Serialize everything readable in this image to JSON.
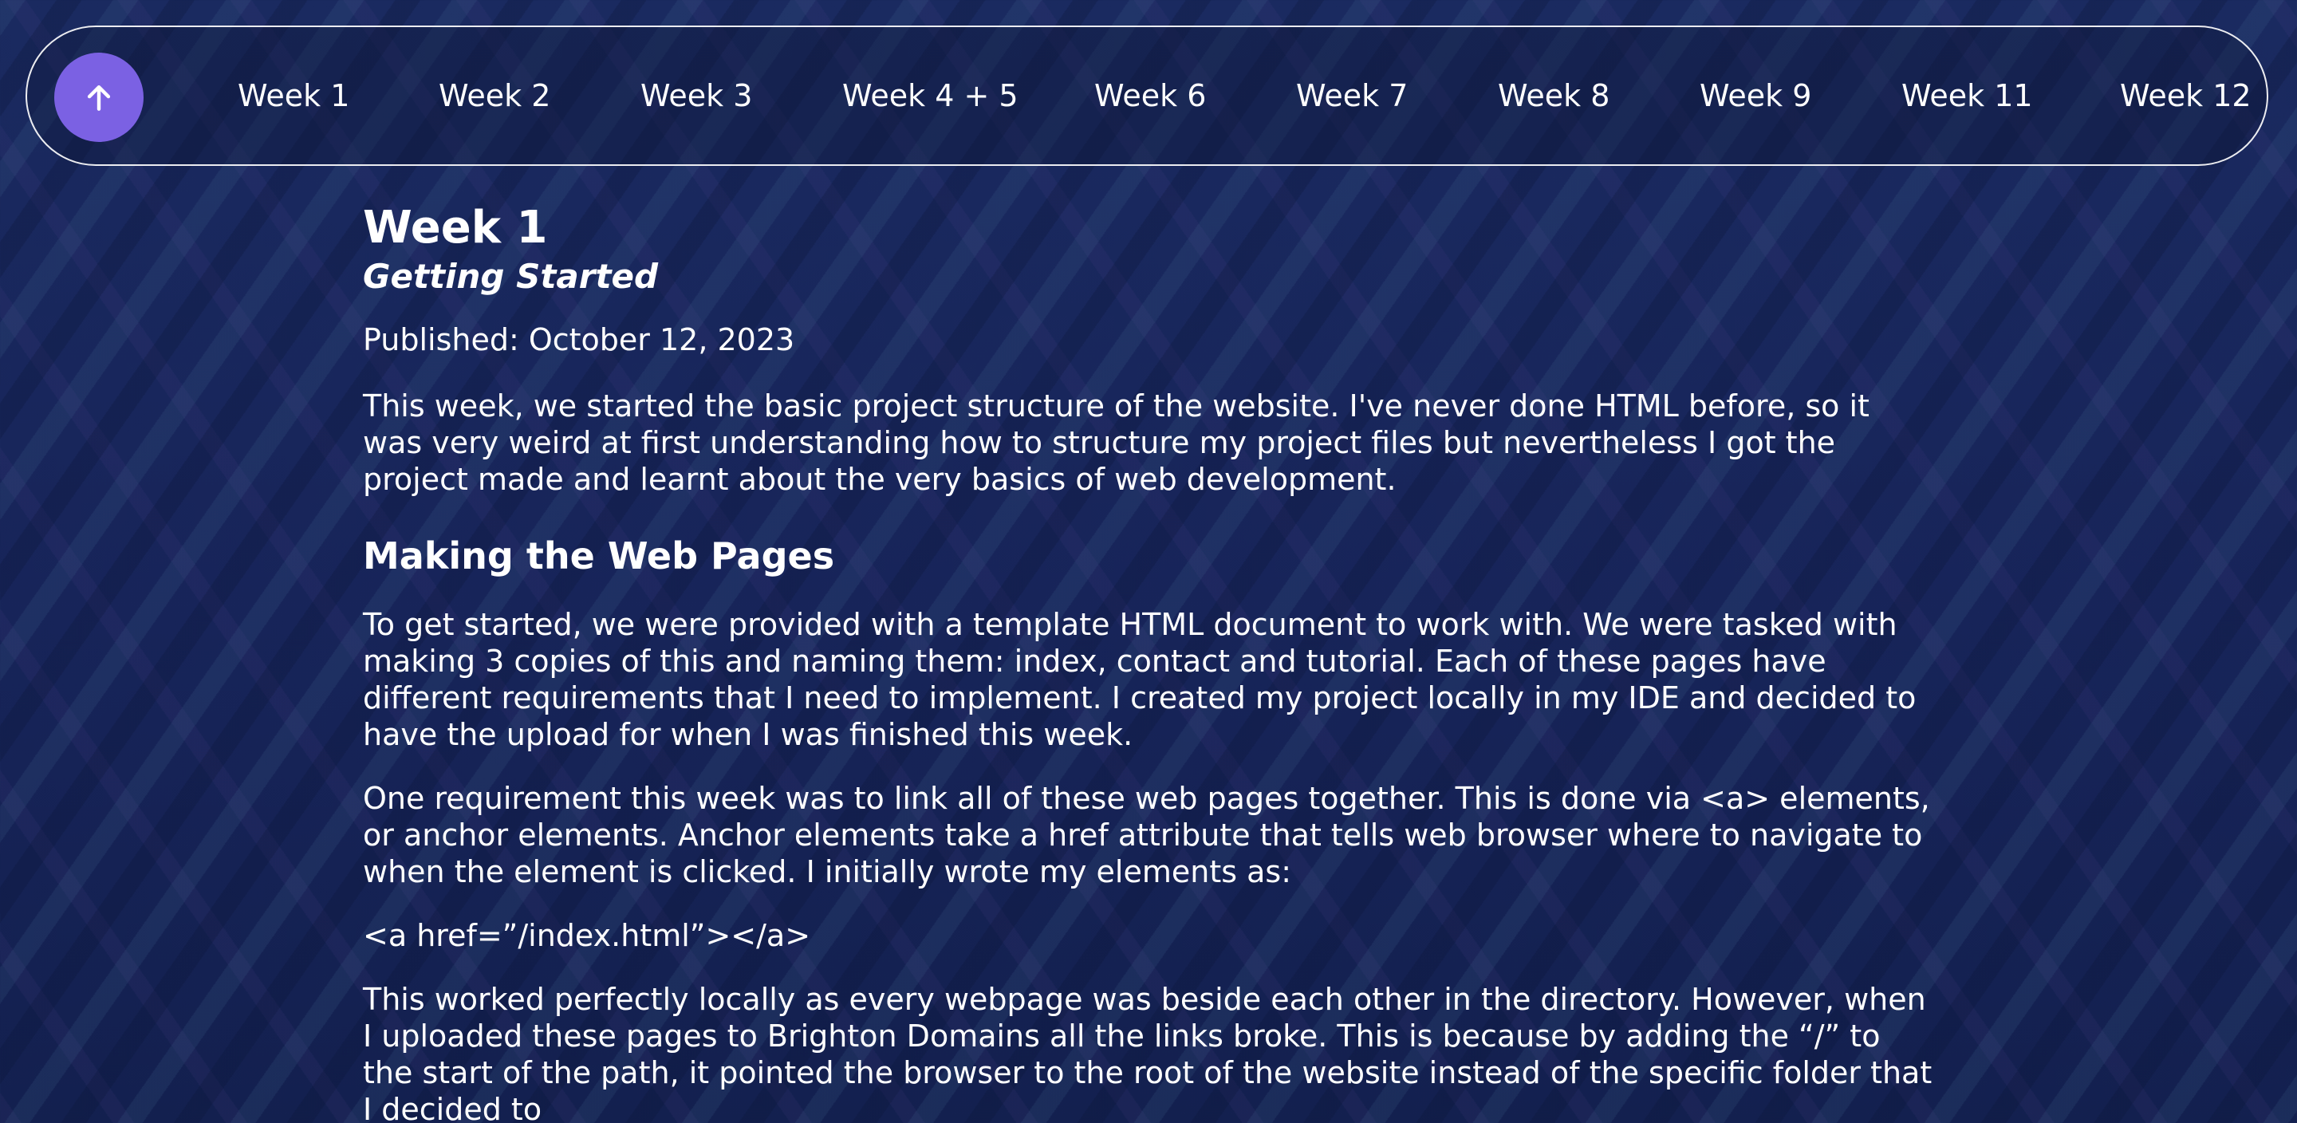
{
  "nav": {
    "back_to_top_icon": "arrow-up-icon",
    "accent_color": "#7b61e3",
    "links": [
      "Week 1",
      "Week 2",
      "Week 3",
      "Week 4 + 5",
      "Week 6",
      "Week 7",
      "Week 8",
      "Week 9",
      "Week 11",
      "Week 12"
    ]
  },
  "article": {
    "title": "Week 1",
    "subtitle": "Getting Started",
    "published": "Published: October 12, 2023",
    "intro": "This week, we started the basic project structure of the website. I've never done HTML before, so it was very weird at first understanding how to structure my project files but nevertheless I got the project made and learnt about the very basics of web development.",
    "section_heading": "Making the Web Pages",
    "paragraph_1": "To get started, we were provided with a template HTML document to work with. We were tasked with making 3 copies of this and naming them: index, contact and tutorial. Each of these pages have different requirements that I need to implement. I created my project locally in my IDE and decided to have the upload for when I was finished this week.",
    "paragraph_2": "One requirement this week was to link all of these web pages together. This is done via <a> elements, or anchor elements. Anchor elements take a href attribute that tells web browser where to navigate to when the element is clicked. I initially wrote my elements as:",
    "code_example": "<a href=”/index.html”></a>",
    "paragraph_3": "This worked perfectly locally as every webpage was beside each other in the directory. However, when I uploaded these pages to Brighton Domains all the links broke. This is because by adding the “/” to the start of the path, it pointed the browser to the root of the website instead of the specific folder that I decided to"
  }
}
